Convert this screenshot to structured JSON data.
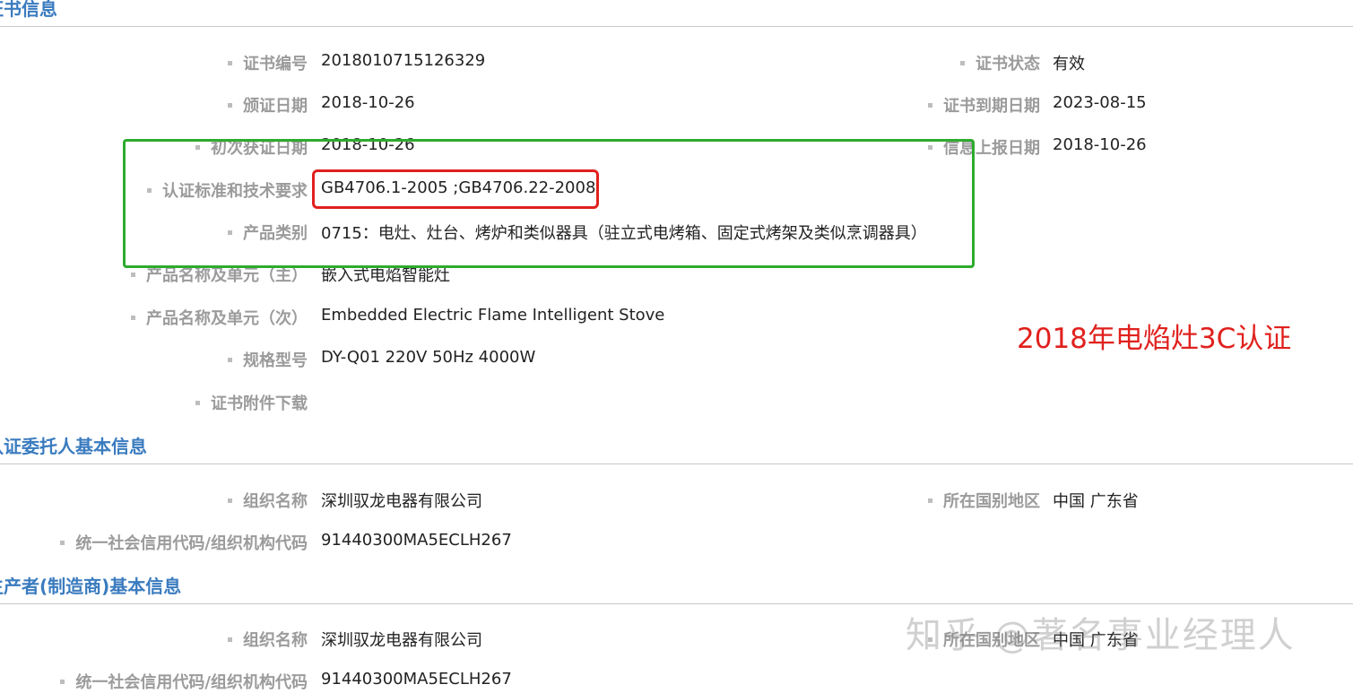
{
  "sections": {
    "certificate": {
      "title": "证书信息"
    },
    "applicant": {
      "title": "认证委托人基本信息"
    },
    "manufacturer": {
      "title": "生产者(制造商)基本信息"
    }
  },
  "certificate": {
    "cert_no": {
      "label": "证书编号",
      "value": "2018010715126329"
    },
    "cert_status": {
      "label": "证书状态",
      "value": "有效"
    },
    "issue_date": {
      "label": "颁证日期",
      "value": "2018-10-26"
    },
    "expiry_date": {
      "label": "证书到期日期",
      "value": "2023-08-15"
    },
    "first_date": {
      "label": "初次获证日期",
      "value": "2018-10-26"
    },
    "report_date": {
      "label": "信息上报日期",
      "value": "2018-10-26"
    },
    "standard": {
      "label": "认证标准和技术要求",
      "value": "GB4706.1-2005 ;GB4706.22-2008"
    },
    "category": {
      "label": "产品类别",
      "value": "0715：电灶、灶台、烤炉和类似器具（驻立式电烤箱、固定式烤架及类似烹调器具）"
    },
    "name_main": {
      "label": "产品名称及单元（主）",
      "value": "嵌入式电焰智能灶"
    },
    "name_sub": {
      "label": "产品名称及单元（次）",
      "value": "Embedded Electric Flame Intelligent Stove"
    },
    "model": {
      "label": "规格型号",
      "value": "DY-Q01 220V 50Hz 4000W"
    },
    "attachment": {
      "label": "证书附件下载"
    }
  },
  "applicant": {
    "org_name": {
      "label": "组织名称",
      "value": "深圳驭龙电器有限公司"
    },
    "region": {
      "label": "所在国别地区",
      "value": "中国 广东省"
    },
    "credit_code": {
      "label": "统一社会信用代码/组织机构代码",
      "value": "91440300MA5ECLH267"
    }
  },
  "manufacturer": {
    "org_name": {
      "label": "组织名称",
      "value": "深圳驭龙电器有限公司"
    },
    "region": {
      "label": "所在国别地区",
      "value": "中国 广东省"
    },
    "credit_code": {
      "label": "统一社会信用代码/组织机构代码",
      "value": "91440300MA5ECLH267"
    }
  },
  "annotation": {
    "text": "2018年电焰灶3C认证"
  },
  "watermark": {
    "text": "知乎 @著名事业经理人"
  },
  "colors": {
    "section_title": "#3a7bbf",
    "label": "#9b9b9b",
    "highlight_green": "#2eab2e",
    "highlight_red": "#e0211d"
  }
}
